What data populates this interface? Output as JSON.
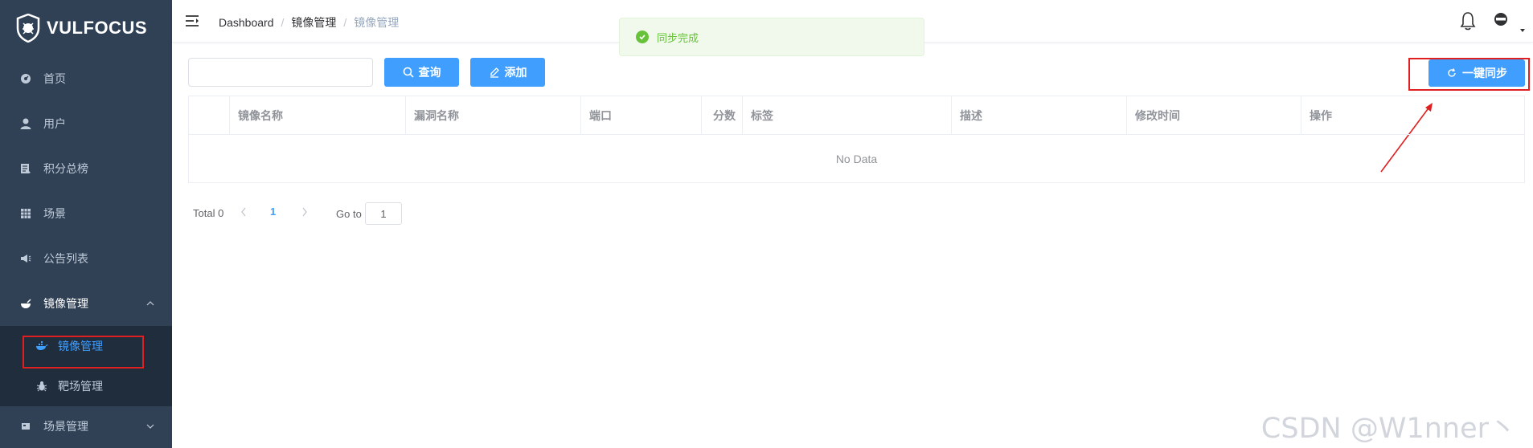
{
  "sidebar": {
    "logo_text": "VULFOCUS",
    "items": [
      {
        "label": "首页",
        "icon": "dashboard-icon"
      },
      {
        "label": "用户",
        "icon": "user-icon"
      },
      {
        "label": "积分总榜",
        "icon": "ranking-icon"
      },
      {
        "label": "场景",
        "icon": "grid-icon"
      },
      {
        "label": "公告列表",
        "icon": "megaphone-icon"
      },
      {
        "label": "镜像管理",
        "icon": "bowl-icon",
        "expanded": true
      },
      {
        "label": "场景管理",
        "icon": "scene-icon",
        "expanded": false
      }
    ],
    "submenu": [
      {
        "label": "镜像管理",
        "icon": "docker-icon",
        "active": true
      },
      {
        "label": "靶场管理",
        "icon": "bug-icon",
        "active": false
      }
    ]
  },
  "header": {
    "breadcrumb": [
      "Dashboard",
      "镜像管理",
      "镜像管理"
    ]
  },
  "toast": {
    "message": "同步完成",
    "type": "success"
  },
  "toolbar": {
    "search_value": "",
    "query_label": "查询",
    "add_label": "添加",
    "sync_label": "一键同步"
  },
  "table": {
    "columns": [
      "",
      "镜像名称",
      "漏洞名称",
      "端口",
      "分数",
      "标签",
      "描述",
      "修改时间",
      "操作"
    ],
    "rows": [],
    "empty_text": "No Data"
  },
  "pagination": {
    "total_label": "Total 0",
    "current_page": "1",
    "goto_label": "Go to",
    "goto_value": "1"
  },
  "watermark": "CSDN @W1nner丶",
  "colors": {
    "sidebar_bg": "#304156",
    "submenu_bg": "#1f2d3d",
    "primary": "#409eff",
    "success": "#67c23a",
    "annotation_red": "#e02020"
  }
}
